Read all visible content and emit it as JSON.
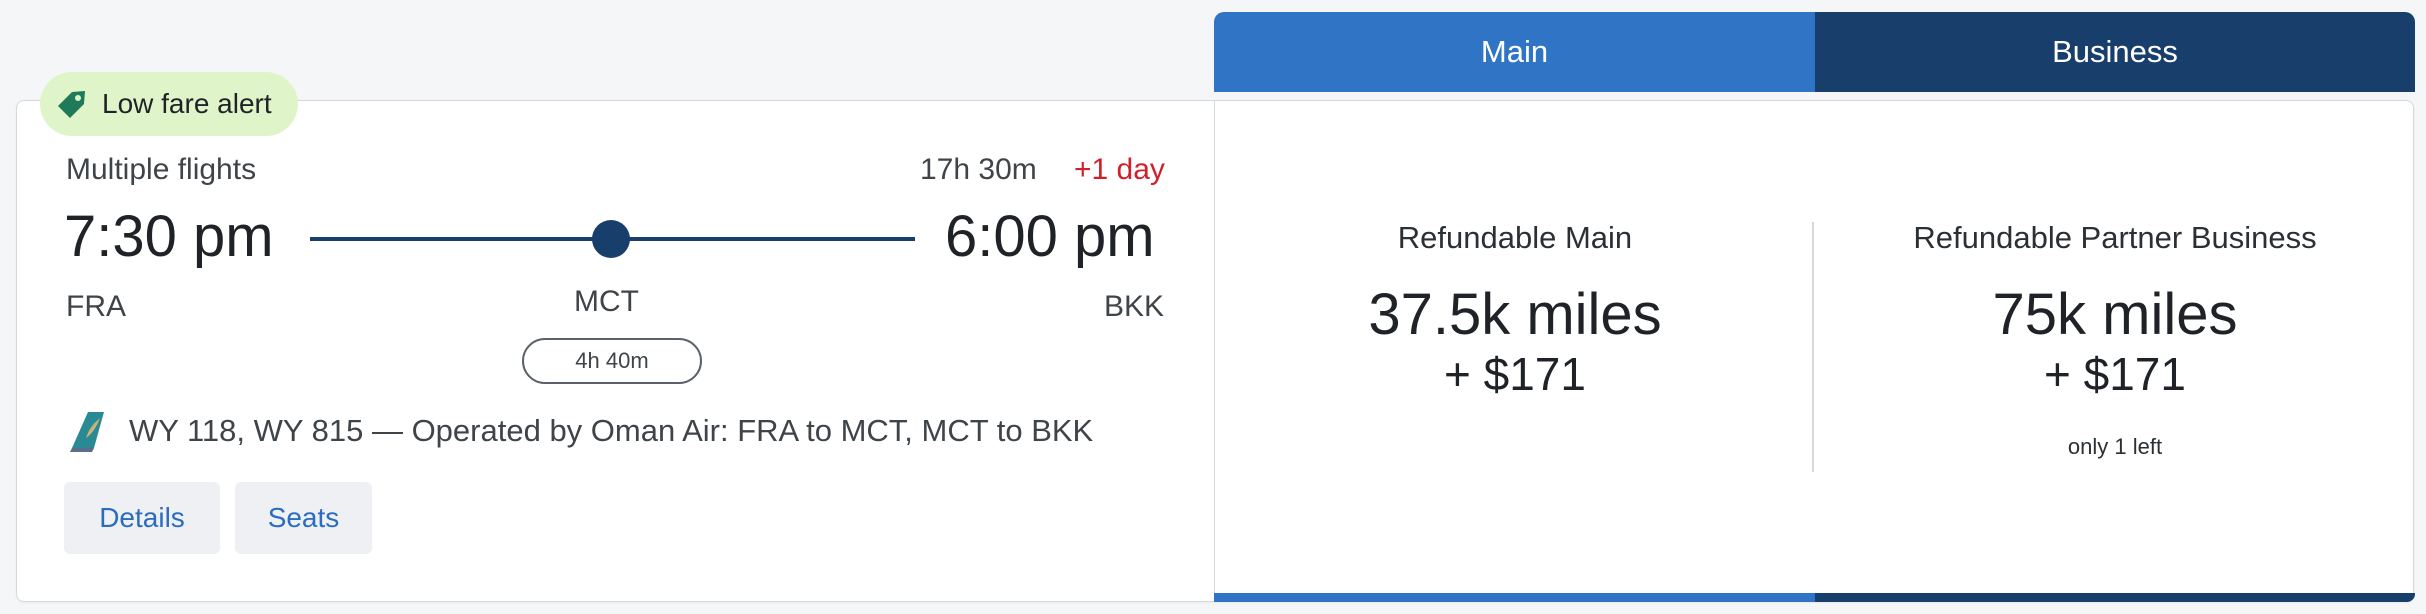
{
  "tabs": {
    "main_label": "Main",
    "business_label": "Business"
  },
  "alert": {
    "label": "Low fare alert",
    "icon": "tag-icon"
  },
  "itinerary": {
    "route_type": "Multiple flights",
    "duration": "17h 30m",
    "day_offset": "+1 day",
    "departure_time": "7:30 pm",
    "arrival_time": "6:00 pm",
    "origin": "FRA",
    "stop": "MCT",
    "destination": "BKK",
    "layover": "4h 40m",
    "operated_by": "WY 118, WY 815 — Operated by Oman Air: FRA to MCT, MCT to BKK",
    "airline_icon": "oman-air-tail-logo"
  },
  "actions": {
    "details_label": "Details",
    "seats_label": "Seats"
  },
  "fares": [
    {
      "name": "Refundable Main",
      "miles": "37.5k miles",
      "tax": "+ $171",
      "note": ""
    },
    {
      "name": "Refundable Partner Business",
      "miles": "75k miles",
      "tax": "+ $171",
      "note": "only 1 left"
    }
  ],
  "colors": {
    "main_tab": "#2f74c5",
    "business_tab": "#183e6b",
    "alert_bg": "#dff5c9",
    "day_offset": "#d21f2c",
    "link": "#2a6cbf"
  }
}
